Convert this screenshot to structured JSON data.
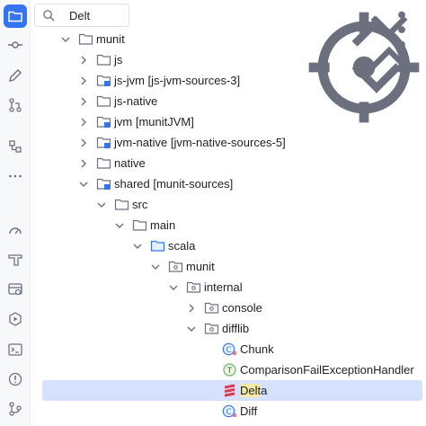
{
  "search": {
    "query": "Delt"
  },
  "toolstrip": {
    "icons": [
      "project-icon",
      "commit-icon",
      "pencil-icon",
      "pull-requests-icon",
      "structure-icon",
      "more-icon",
      "profiler-icon",
      "build-icon",
      "services-icon",
      "run-icon",
      "terminal-icon",
      "problems-icon",
      "git-icon"
    ]
  },
  "tree": {
    "rows": [
      {
        "label": "munit",
        "depth": 0,
        "expanded": true,
        "icon": "folder-icon"
      },
      {
        "label": "js",
        "depth": 1,
        "expanded": false,
        "icon": "folder-icon"
      },
      {
        "label": "js-jvm [js-jvm-sources-3]",
        "depth": 1,
        "expanded": false,
        "icon": "module-folder-icon"
      },
      {
        "label": "js-native",
        "depth": 1,
        "expanded": false,
        "icon": "folder-icon"
      },
      {
        "label": "jvm [munitJVM]",
        "depth": 1,
        "expanded": false,
        "icon": "module-folder-icon"
      },
      {
        "label": "jvm-native [jvm-native-sources-5]",
        "depth": 1,
        "expanded": false,
        "icon": "module-folder-icon"
      },
      {
        "label": "native",
        "depth": 1,
        "expanded": false,
        "icon": "folder-icon"
      },
      {
        "label": "shared [munit-sources]",
        "depth": 1,
        "expanded": true,
        "icon": "module-folder-icon"
      },
      {
        "label": "src",
        "depth": 2,
        "expanded": true,
        "icon": "folder-icon"
      },
      {
        "label": "main",
        "depth": 3,
        "expanded": true,
        "icon": "folder-icon"
      },
      {
        "label": "scala",
        "depth": 4,
        "expanded": true,
        "icon": "source-folder-icon"
      },
      {
        "label": "munit",
        "depth": 5,
        "expanded": true,
        "icon": "package-icon"
      },
      {
        "label": "internal",
        "depth": 6,
        "expanded": true,
        "icon": "package-icon"
      },
      {
        "label": "console",
        "depth": 7,
        "expanded": false,
        "icon": "package-icon"
      },
      {
        "label": "difflib",
        "depth": 7,
        "expanded": true,
        "icon": "package-icon"
      },
      {
        "label": "Chunk",
        "depth": 8,
        "expanded": null,
        "icon": "scala-class-icon"
      },
      {
        "label": "ComparisonFailExceptionHandler",
        "depth": 8,
        "expanded": null,
        "icon": "scala-trait-icon"
      },
      {
        "label_pre": "",
        "label_hl": "Delt",
        "label_post": "a",
        "depth": 8,
        "expanded": null,
        "icon": "scala-object-icon",
        "selected": true
      },
      {
        "label": "Diff",
        "depth": 8,
        "expanded": null,
        "icon": "scala-class-icon"
      }
    ]
  }
}
